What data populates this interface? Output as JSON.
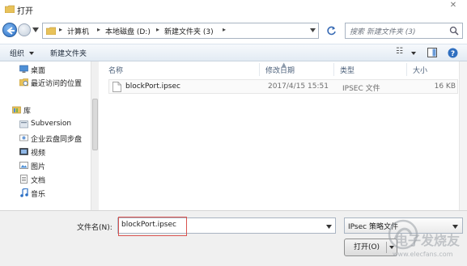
{
  "window": {
    "title": "打开",
    "close_glyph": "✕"
  },
  "address": {
    "crumbs": [
      "计算机",
      "本地磁盘 (D:)",
      "新建文件夹 (3)"
    ],
    "search_placeholder": "搜索 新建文件夹 (3)"
  },
  "toolbar": {
    "organize": "组织",
    "new_folder": "新建文件夹"
  },
  "nav": {
    "favorites": [
      {
        "label": "桌面",
        "icon": "desktop-icon"
      },
      {
        "label": "最近访问的位置",
        "icon": "recent-places-icon"
      }
    ],
    "library_header": "库",
    "libraries": [
      {
        "label": "Subversion",
        "icon": "subversion-icon"
      },
      {
        "label": "企业云盘同步盘",
        "icon": "cloud-drive-icon"
      },
      {
        "label": "视频",
        "icon": "video-library-icon"
      },
      {
        "label": "图片",
        "icon": "picture-library-icon"
      },
      {
        "label": "文档",
        "icon": "documents-library-icon"
      },
      {
        "label": "音乐",
        "icon": "music-library-icon"
      }
    ]
  },
  "columns": {
    "name": "名称",
    "modified": "修改日期",
    "type": "类型",
    "size": "大小"
  },
  "files": [
    {
      "name": "blockPort.ipsec",
      "modified": "2017/4/15 15:51",
      "type": "IPSEC 文件",
      "size": "16 KB"
    }
  ],
  "bottom": {
    "filename_label": "文件名(N):",
    "filename_value": "blockPort.ipsec",
    "filetype_value": "IPsec 策略文件",
    "open_button": "打开(O)"
  },
  "watermark": {
    "text": "电子发烧友",
    "url": "www.elecfans.com"
  },
  "colors": {
    "highlight_box": "#d9534f",
    "accent": "#2b6fc4"
  }
}
